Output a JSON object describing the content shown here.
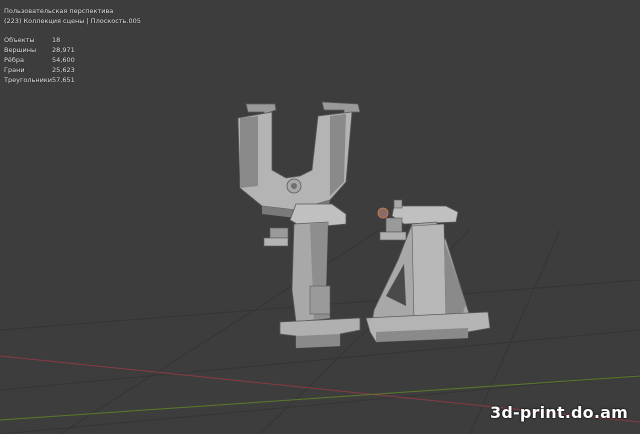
{
  "viewport": {
    "view_name": "Пользовательская перспектива",
    "collection_line": "(223) Коллекция сцены | Плоскость.005",
    "stats": [
      {
        "label": "Объекты",
        "value": "18"
      },
      {
        "label": "Вершины",
        "value": "28,971"
      },
      {
        "label": "Рёбра",
        "value": "54,600"
      },
      {
        "label": "Грани",
        "value": "25,623"
      },
      {
        "label": "Треугольники",
        "value": "57,651"
      }
    ]
  },
  "watermark": "3d-print.do.am",
  "colors": {
    "background": "#3d3d3d",
    "grid_line": "#353535",
    "x_axis": "#8a3a44",
    "y_axis": "#5c7a28",
    "model_light": "#b8b8b8",
    "model_mid": "#9a9a9a",
    "model_dark": "#6e6e6e"
  }
}
